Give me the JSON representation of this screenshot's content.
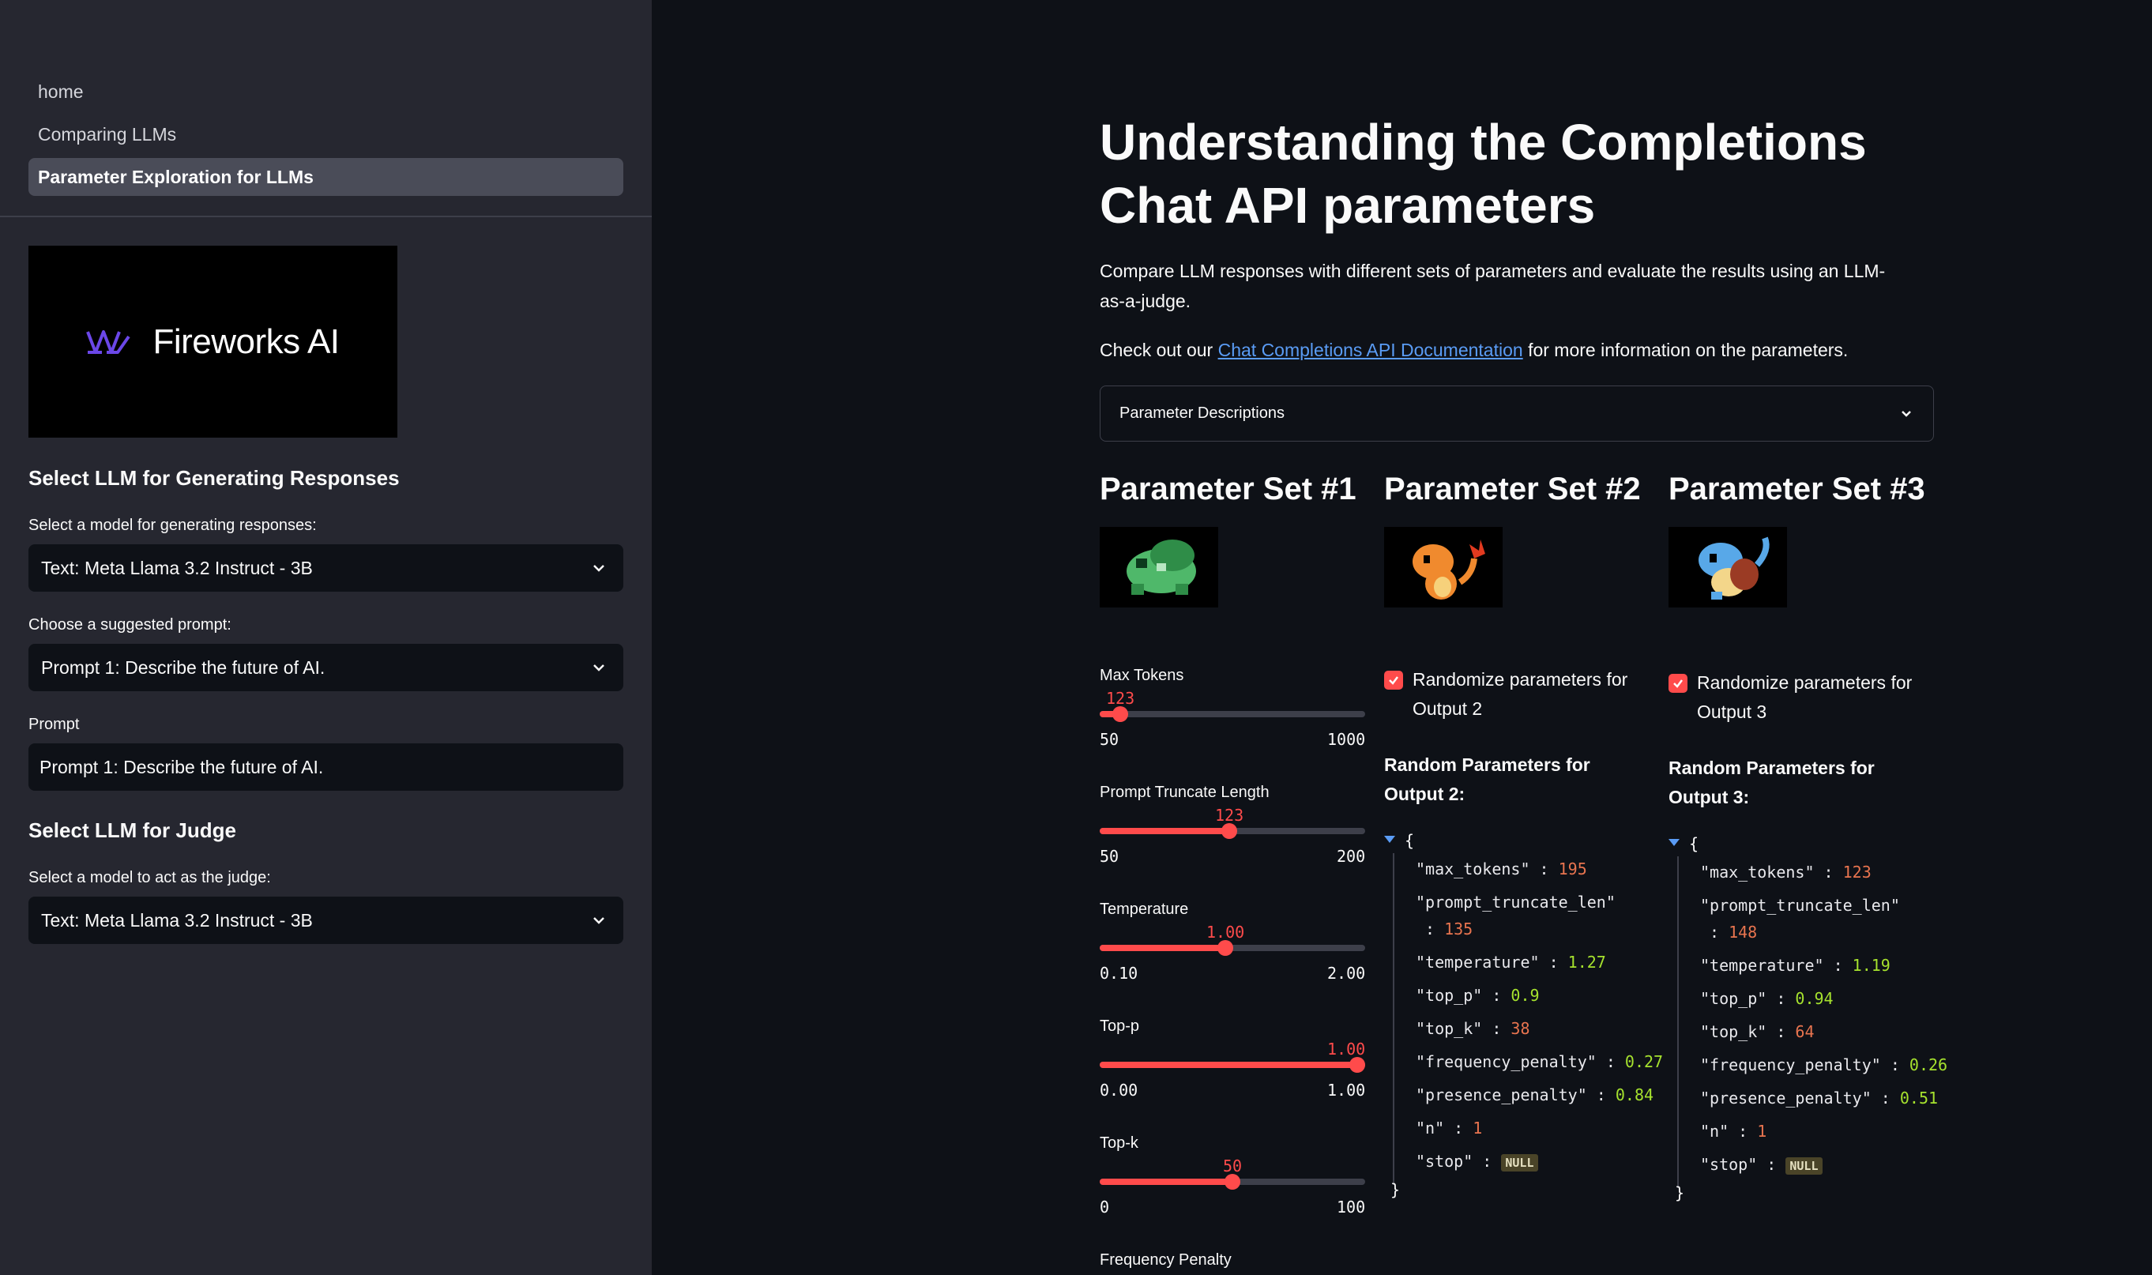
{
  "sidebar": {
    "nav": [
      "home",
      "Comparing LLMs",
      "Parameter Exploration for LLMs"
    ],
    "active_nav": 2,
    "logo_text": "Fireworks AI",
    "gen_heading": "Select LLM for Generating Responses",
    "gen_model_label": "Select a model for generating responses:",
    "gen_model_value": "Text: Meta Llama 3.2 Instruct - 3B",
    "prompt_choice_label": "Choose a suggested prompt:",
    "prompt_choice_value": "Prompt 1: Describe the future of AI.",
    "prompt_label": "Prompt",
    "prompt_value": "Prompt 1: Describe the future of AI.",
    "judge_heading": "Select LLM for Judge",
    "judge_model_label": "Select a model to act as the judge:",
    "judge_model_value": "Text: Meta Llama 3.2 Instruct - 3B"
  },
  "main": {
    "title": "Understanding the Completions Chat API parameters",
    "description": "Compare LLM responses with different sets of parameters and evaluate the results using an LLM-as-a-judge.",
    "docs_prefix": "Check out our ",
    "docs_link": "Chat Completions API Documentation",
    "docs_suffix": " for more information on the parameters.",
    "expander_label": "Parameter Descriptions",
    "set1": {
      "heading": "Parameter Set #1",
      "sliders": [
        {
          "label": "Max Tokens",
          "value": "123",
          "min": "50",
          "max": "1000",
          "fraction": 0.077
        },
        {
          "label": "Prompt Truncate Length",
          "value": "123",
          "min": "50",
          "max": "200",
          "fraction": 0.487
        },
        {
          "label": "Temperature",
          "value": "1.00",
          "min": "0.10",
          "max": "2.00",
          "fraction": 0.474
        },
        {
          "label": "Top-p",
          "value": "1.00",
          "min": "0.00",
          "max": "1.00",
          "fraction": 1.0
        },
        {
          "label": "Top-k",
          "value": "50",
          "min": "0",
          "max": "100",
          "fraction": 0.5
        }
      ],
      "next_label": "Frequency Penalty"
    },
    "set2": {
      "heading": "Parameter Set #2",
      "checkbox_label": "Randomize parameters for Output 2",
      "random_title": "Random Parameters for Output 2:",
      "params": {
        "max_tokens": "195",
        "prompt_truncate_len": "135",
        "temperature": "1.27",
        "top_p": "0.9",
        "top_k": "38",
        "frequency_penalty": "0.27",
        "presence_penalty": "0.84",
        "n": "1",
        "stop": "NULL"
      }
    },
    "set3": {
      "heading": "Parameter Set #3",
      "checkbox_label": "Randomize parameters for Output 3",
      "random_title": "Random Parameters for Output 3:",
      "params": {
        "max_tokens": "123",
        "prompt_truncate_len": "148",
        "temperature": "1.19",
        "top_p": "0.94",
        "top_k": "64",
        "frequency_penalty": "0.26",
        "presence_penalty": "0.51",
        "n": "1",
        "stop": "NULL"
      }
    }
  },
  "colors": {
    "accent": "#ff4b4b",
    "link": "#5a9cf5",
    "sidebar_bg": "#262730",
    "main_bg": "#0e1117",
    "json_int": "#e8744f",
    "json_decimal": "#a6e22e"
  }
}
